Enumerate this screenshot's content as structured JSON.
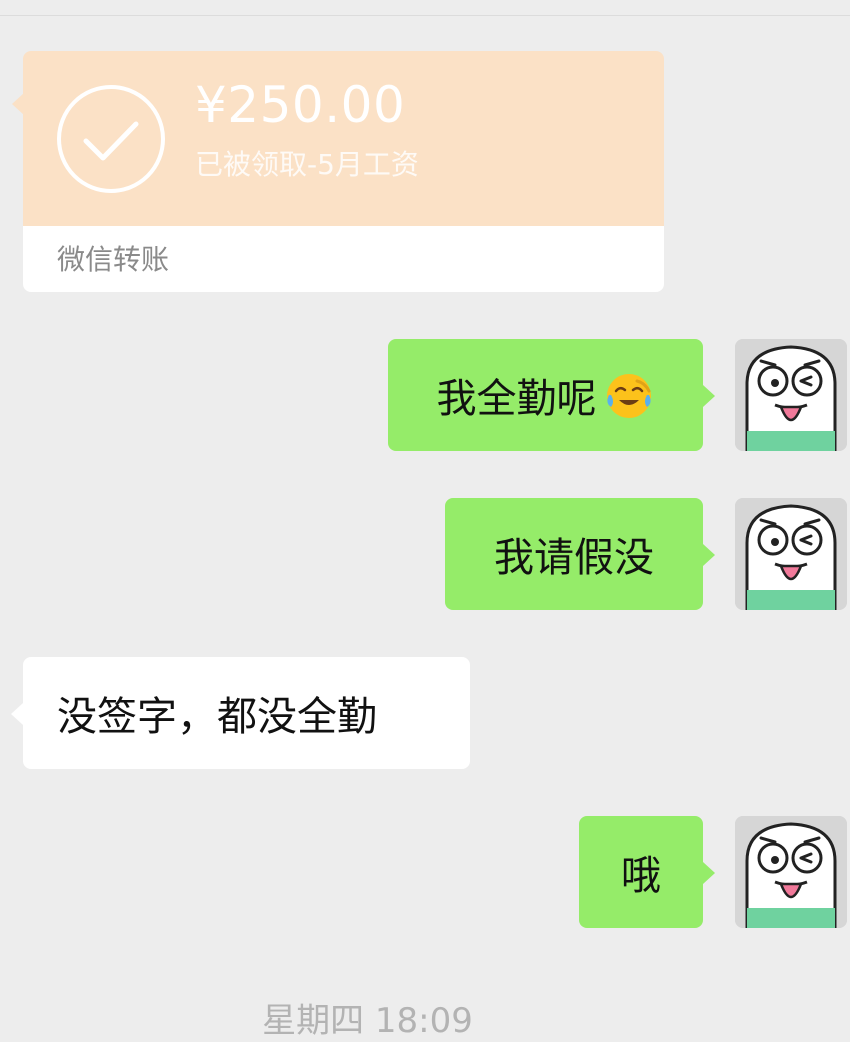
{
  "transfer": {
    "amount": "¥250.00",
    "status": "已被领取-5月工资",
    "label": "微信转账",
    "icon": "check-circle-icon"
  },
  "messages": [
    {
      "side": "sent",
      "text": "我全勤呢",
      "emoji": "face-with-tears-of-joy-icon"
    },
    {
      "side": "sent",
      "text": "我请假没"
    },
    {
      "side": "received",
      "text": "没签字，都没全勤"
    },
    {
      "side": "sent",
      "text": "哦"
    }
  ],
  "timestamp": "星期四 18:09",
  "colors": {
    "background": "#ededed",
    "sent_bubble": "#95ec69",
    "received_bubble": "#ffffff",
    "transfer_accent": "#fbe1c6"
  }
}
